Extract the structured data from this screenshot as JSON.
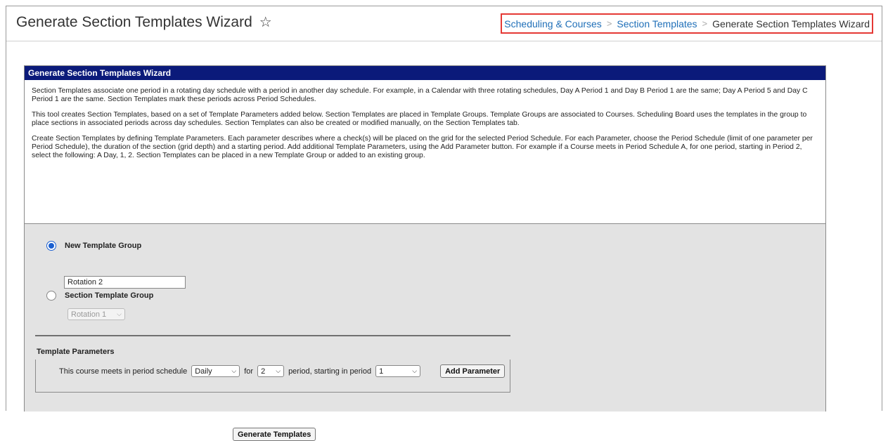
{
  "header": {
    "title": "Generate Section Templates Wizard",
    "breadcrumb": [
      "Scheduling & Courses",
      "Section Templates",
      "Generate Section Templates Wizard"
    ],
    "separator": ">"
  },
  "wizard": {
    "title": "Generate Section Templates Wizard",
    "paragraphs": [
      "Section Templates associate one period in a rotating day schedule with a period in another day schedule. For example, in a Calendar with three rotating schedules, Day A Period 1 and Day B Period 1 are the same; Day A Period 5 and Day C Period 1 are the same. Section Templates mark these periods across Period Schedules.",
      "This tool creates Section Templates, based on a set of Template Parameters added below. Section Templates are placed in Template Groups. Template Groups are associated to Courses. Scheduling Board uses the templates in the group to place sections in associated periods across day schedules. Section Templates can also be created or modified manually, on the Section Templates tab.",
      "Create Section Templates by defining Template Parameters. Each parameter describes where a check(s) will be placed on the grid for the selected Period Schedule. For each Parameter, choose the Period Schedule (limit of one parameter per Period Schedule), the duration of the section (grid depth) and a starting period. Add additional Template Parameters, using the Add Parameter button. For example if a Course meets in Period Schedule A, for one period, starting in Period 2, select the following: A Day, 1, 2. Section Templates can be placed in a new Template Group or added to an existing group."
    ]
  },
  "options": {
    "new_group_label": "New Template Group",
    "new_group_value": "Rotation 2",
    "section_group_label": "Section Template Group",
    "section_group_selected": "Rotation 1",
    "selected": "new"
  },
  "params": {
    "title": "Template Parameters",
    "prefix": "This course meets in period schedule",
    "schedule_value": "Daily",
    "for_label": "for",
    "duration_value": "2",
    "starting_label": "period, starting in period",
    "start_value": "1",
    "add_button": "Add Parameter"
  },
  "generate_button": "Generate Templates",
  "colors": {
    "wizard_header_bg": "#0b1a7a",
    "link": "#1f6fb8",
    "highlight_border": "#e53935",
    "radio_selected": "#1a5fd0"
  }
}
